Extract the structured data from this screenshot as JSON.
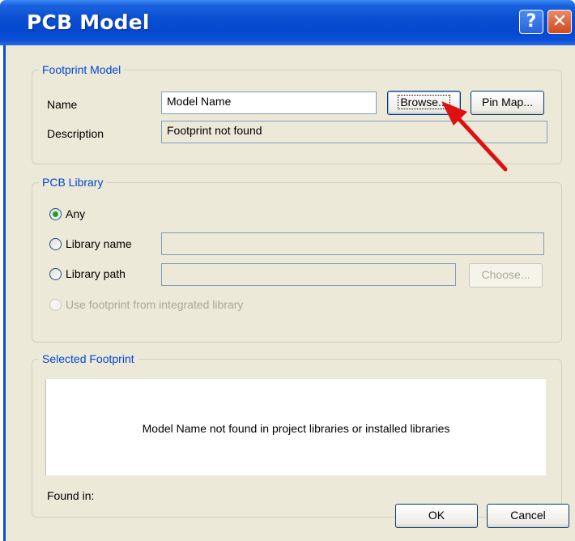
{
  "window": {
    "title": "PCB Model",
    "help_symbol": "?",
    "close_symbol": "✕"
  },
  "footprint_model": {
    "legend": "Footprint Model",
    "name_label": "Name",
    "name_value": "Model Name",
    "browse_label": "Browse...",
    "pinmap_label": "Pin Map...",
    "description_label": "Description",
    "description_value": "Footprint not found"
  },
  "pcb_library": {
    "legend": "PCB Library",
    "options": {
      "any": {
        "label": "Any",
        "checked": true
      },
      "library_name": {
        "label": "Library name",
        "checked": false
      },
      "library_path": {
        "label": "Library path",
        "checked": false
      },
      "integrated": {
        "label": "Use footprint from integrated library",
        "checked": false,
        "disabled": true
      }
    },
    "library_name_value": "",
    "library_path_value": "",
    "choose_label": "Choose..."
  },
  "selected_footprint": {
    "legend": "Selected Footprint",
    "message": "Model Name not found in project libraries or installed libraries",
    "found_in_label": "Found in:"
  },
  "footer": {
    "ok_label": "OK",
    "cancel_label": "Cancel"
  },
  "annotation": {
    "arrow_color": "#e01010"
  }
}
